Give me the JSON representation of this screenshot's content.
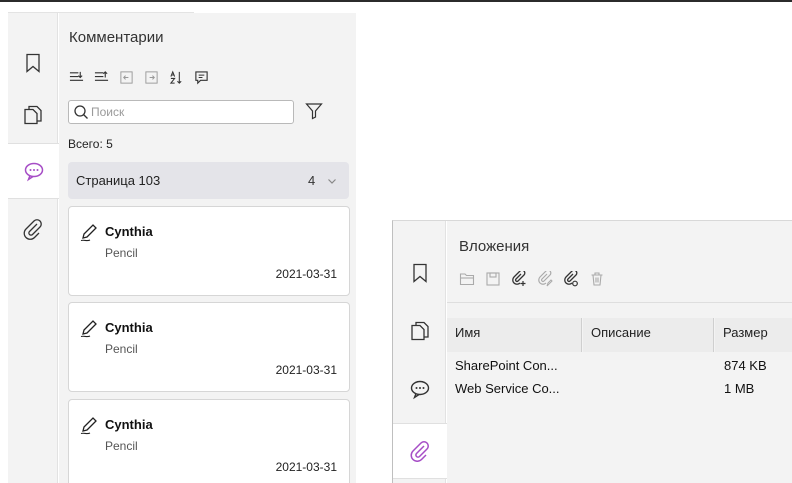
{
  "comments_panel": {
    "title": "Комментарии",
    "search_placeholder": "Поиск",
    "total": "Всего: 5",
    "page_group": {
      "label": "Страница 103",
      "count": "4"
    },
    "cards": [
      {
        "author": "Cynthia",
        "type": "Pencil",
        "date": "2021-03-31"
      },
      {
        "author": "Cynthia",
        "type": "Pencil",
        "date": "2021-03-31"
      },
      {
        "author": "Cynthia",
        "type": "Pencil",
        "date": "2021-03-31"
      }
    ],
    "toolbar_icons": [
      "expand-all-icon",
      "collapse-all-icon",
      "previous-icon",
      "next-icon",
      "sort-icon",
      "comment-icon"
    ],
    "rail_icons": [
      "bookmark-icon",
      "pages-icon",
      "comments-icon",
      "attachment-icon"
    ],
    "active_rail": "comments-icon"
  },
  "attachments_panel": {
    "title": "Вложения",
    "toolbar_icons": [
      "open-icon",
      "save-icon",
      "add-attachment-icon",
      "edit-attachment-icon",
      "attachment-settings-icon",
      "delete-icon"
    ],
    "columns": [
      "Имя",
      "Описание",
      "Размер"
    ],
    "rows": [
      {
        "name": "SharePoint Con...",
        "description": "",
        "size": "874 KB"
      },
      {
        "name": "Web Service Co...",
        "description": "",
        "size": "1 MB"
      }
    ],
    "active_rail": "attachment-icon"
  },
  "colors": {
    "accent": "#a64dc6",
    "panel_bg": "#f3f3f3",
    "group_bg": "#e4e4e9"
  }
}
